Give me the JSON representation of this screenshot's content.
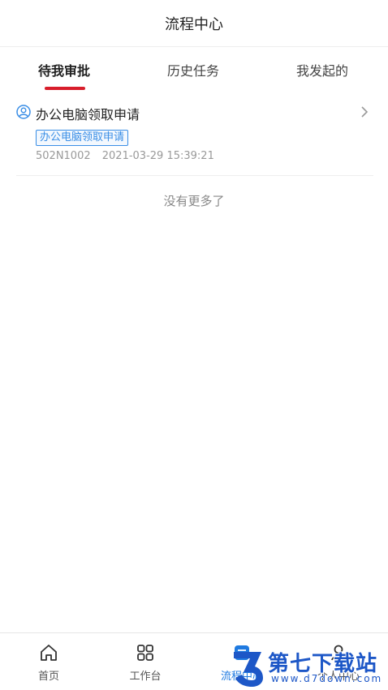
{
  "header": {
    "title": "流程中心"
  },
  "tabs": [
    {
      "label": "待我审批",
      "active": true
    },
    {
      "label": "历史任务",
      "active": false
    },
    {
      "label": "我发起的",
      "active": false
    }
  ],
  "item": {
    "title": "办公电脑领取申请",
    "tag": "办公电脑领取申请",
    "code": "502N1002",
    "time": "2021-03-29 15:39:21",
    "icon": "user-circle-icon"
  },
  "list_footer": "没有更多了",
  "tabbar": [
    {
      "label": "首页",
      "icon": "home-icon",
      "active": false
    },
    {
      "label": "工作台",
      "icon": "grid-icon",
      "active": false
    },
    {
      "label": "流程中心",
      "icon": "flow-icon",
      "active": true
    },
    {
      "label": "个人中心",
      "icon": "user-icon",
      "active": false
    }
  ],
  "watermark": {
    "brand": "第七下载站",
    "url": "www.d7down.com"
  },
  "colors": {
    "accent": "#d81e2b",
    "link": "#3a8ee6",
    "tab_active": "#1f7ae0"
  }
}
